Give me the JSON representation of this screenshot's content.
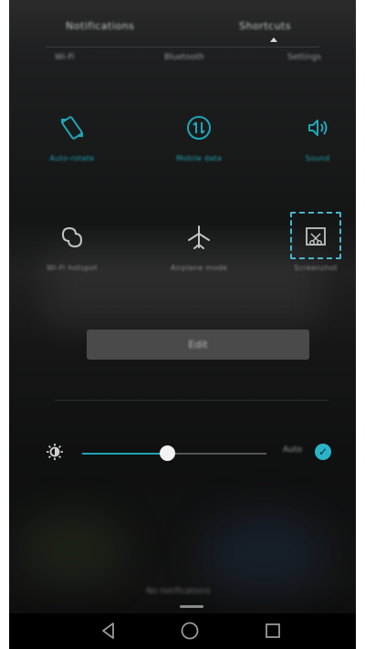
{
  "header": {
    "tabs": [
      {
        "label": "Notifications"
      },
      {
        "label": "Shortcuts"
      }
    ],
    "small_tiles": [
      {
        "label": "Wi-Fi"
      },
      {
        "label": "Bluetooth"
      },
      {
        "label": "Settings"
      }
    ]
  },
  "toggles": [
    {
      "label": "Auto-rotate",
      "icon": "auto-rotate-icon",
      "state": "on"
    },
    {
      "label": "Mobile data",
      "icon": "mobile-data-icon",
      "state": "on"
    },
    {
      "label": "Sound",
      "icon": "sound-icon",
      "state": "on"
    },
    {
      "label": "Wi-Fi hotspot",
      "icon": "hotspot-icon",
      "state": "off"
    },
    {
      "label": "Airplane mode",
      "icon": "airplane-icon",
      "state": "off"
    },
    {
      "label": "Screenshot",
      "icon": "screenshot-icon",
      "state": "off"
    }
  ],
  "edit_button": {
    "label": "Edit"
  },
  "brightness": {
    "level": 0.46,
    "auto_label": "Auto"
  },
  "footer": {
    "text": "No notifications"
  },
  "colors": {
    "accent": "#1fa6b8",
    "highlight": "#46b7cf",
    "background": "#161616"
  }
}
